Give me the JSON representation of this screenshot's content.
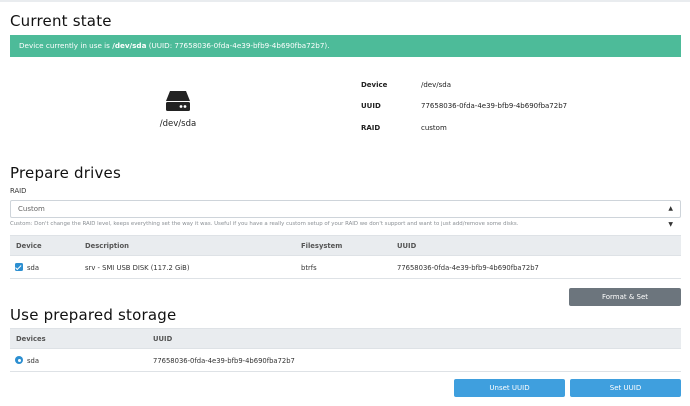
{
  "current_state": {
    "heading": "Current state",
    "alert_prefix": "Device currently in use is ",
    "alert_device": "/dev/sda",
    "alert_suffix": " (UUID: 77658036-0fda-4e39-bfb9-4b690fba72b7).",
    "drive_label": "/dev/sda",
    "device_key": "Device",
    "device_val": "/dev/sda",
    "uuid_key": "UUID",
    "uuid_val": "77658036-0fda-4e39-bfb9-4b690fba72b7",
    "raid_key": "RAID",
    "raid_val": "custom"
  },
  "prepare": {
    "heading": "Prepare drives",
    "raid_label": "RAID",
    "raid_selected": "Custom",
    "raid_help": "Custom: Don't change the RAID level, keeps everything set the way it was. Useful if you have a really custom setup of your RAID we don't support and want to just add/remove some disks.",
    "columns": [
      "Device",
      "Description",
      "Filesystem",
      "UUID"
    ],
    "rows": [
      {
        "device": "sda",
        "description": "srv - SMI USB DISK (117.2 GiB)",
        "filesystem": "btrfs",
        "uuid": "77658036-0fda-4e39-bfb9-4b690fba72b7",
        "checked": true
      }
    ],
    "format_button": "Format & Set"
  },
  "use": {
    "heading": "Use prepared storage",
    "columns": [
      "Devices",
      "UUID"
    ],
    "rows": [
      {
        "device": "sda",
        "uuid": "77658036-0fda-4e39-bfb9-4b690fba72b7",
        "selected": true
      }
    ],
    "unset_button": "Unset UUID",
    "set_button": "Set UUID"
  },
  "colors": {
    "alert_green": "#4dbb99",
    "primary_blue": "#3f9fde",
    "secondary_grey": "#6c757d"
  },
  "icons": [
    "hard-drive-icon",
    "checkbox-checked-icon",
    "radio-selected-icon",
    "select-caret-icon"
  ]
}
